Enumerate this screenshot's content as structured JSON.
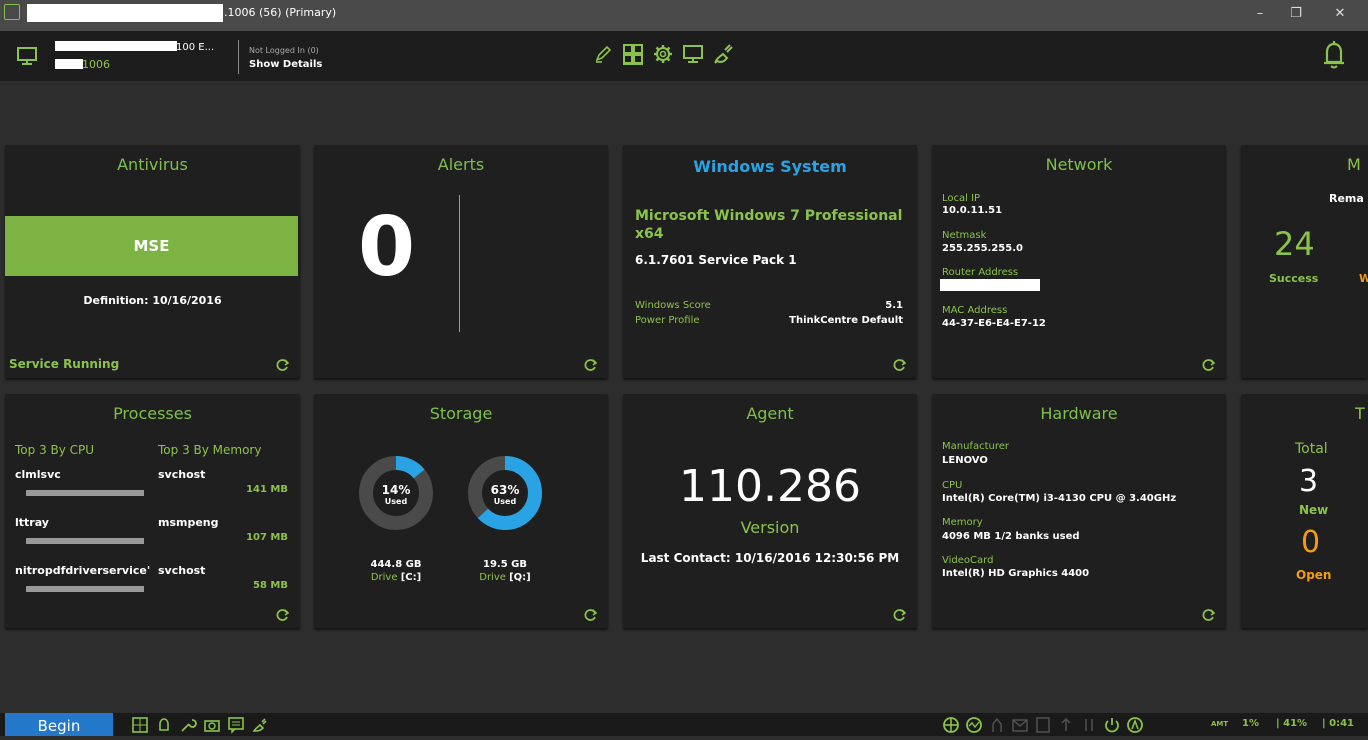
{
  "window": {
    "title": ".1006 (56) (Primary)",
    "min": "–",
    "restore": "❐",
    "close": "✕"
  },
  "topbar": {
    "host_name_suffix": "100 E...",
    "host_id_suffix": "1006",
    "login_status": "Not Logged In (0)",
    "show_details": "Show Details",
    "nav_icons": [
      "edit-icon",
      "dashboard-icon",
      "settings-icon",
      "monitor-icon",
      "plug-icon"
    ]
  },
  "antivirus": {
    "title": "Antivirus",
    "product": "MSE",
    "definition": "Definition: 10/16/2016",
    "status": "Service Running"
  },
  "alerts": {
    "title": "Alerts",
    "count": "0"
  },
  "windows_system": {
    "title": "Windows System",
    "os": "Microsoft Windows 7 Professional x64",
    "version": "6.1.7601 Service Pack 1",
    "score_label": "Windows Score",
    "score_value": "5.1",
    "power_label": "Power Profile",
    "power_value": "ThinkCentre Default"
  },
  "network": {
    "title": "Network",
    "local_ip_label": "Local IP",
    "local_ip": "10.0.11.51",
    "netmask_label": "Netmask",
    "netmask": "255.255.255.0",
    "router_label": "Router Address",
    "mac_label": "MAC Address",
    "mac": "44-37-E6-E4-E7-12"
  },
  "m_card": {
    "title": "M",
    "subtitle": "Rema",
    "count": "24",
    "success_label": "Success",
    "partial_label": "W"
  },
  "processes": {
    "title": "Processes",
    "cpu_header": "Top 3 By CPU",
    "mem_header": "Top 3 By Memory",
    "rows": [
      {
        "cpu": "clmlsvc",
        "mem": "svchost",
        "mem_size": "141 MB"
      },
      {
        "cpu": "lttray",
        "mem": "msmpeng",
        "mem_size": "107 MB"
      },
      {
        "cpu": "nitropdfdriverservice'",
        "mem": "svchost",
        "mem_size": "58 MB"
      }
    ]
  },
  "storage": {
    "title": "Storage",
    "drives": [
      {
        "pct": "14%",
        "used": "Used",
        "size": "444.8 GB",
        "drive_label": "Drive",
        "drive_letter": "[C:]",
        "fraction": 0.14
      },
      {
        "pct": "63%",
        "used": "Used",
        "size": "19.5 GB",
        "drive_label": "Drive",
        "drive_letter": "[Q:]",
        "fraction": 0.63
      }
    ]
  },
  "agent": {
    "title": "Agent",
    "version_number": "110.286",
    "version_label": "Version",
    "last_contact": "Last Contact: 10/16/2016 12:30:56 PM"
  },
  "hardware": {
    "title": "Hardware",
    "manufacturer_label": "Manufacturer",
    "manufacturer": "LENOVO",
    "cpu_label": "CPU",
    "cpu": "Intel(R) Core(TM) i3-4130 CPU @ 3.40GHz",
    "memory_label": "Memory",
    "memory": "4096 MB 1/2 banks used",
    "video_label": "VideoCard",
    "video": "Intel(R) HD Graphics 4400"
  },
  "tickets": {
    "title": "T",
    "total_label": "Total",
    "new_count": "3",
    "new_label": "New",
    "open_count": "0",
    "open_label": "Open"
  },
  "taskbar": {
    "begin": "Begin",
    "amt": "AMT",
    "cpu_pct": "1%",
    "mem_pct": "| 41%",
    "time": "| 0:41"
  },
  "colors": {
    "accent_green": "#8bc34a",
    "title_green": "#7ec04b",
    "windows_blue": "#29a3e3",
    "open_orange": "#f39c12",
    "begin_blue": "#2478c9"
  }
}
